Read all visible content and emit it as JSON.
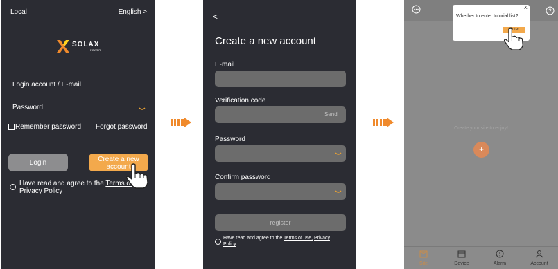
{
  "login": {
    "local": "Local",
    "language": "English >",
    "logo_text": "SOLAX",
    "logo_sub": "POWER",
    "account_label": "Login account / E-mail",
    "password_label": "Password",
    "remember": "Remember password",
    "forgot": "Forgot password",
    "login_button": "Login",
    "create_button_line1": "Create a new",
    "create_button_line2": "account",
    "agree_text": "Have read and agree to the ",
    "terms_link": "Terms of use",
    "privacy_link": "Privacy Policy"
  },
  "register": {
    "back": "<",
    "title": "Create a new account",
    "email_label": "E-mail",
    "code_label": "Verification code",
    "send": "Send",
    "password_label": "Password",
    "confirm_label": "Confirm password",
    "register_button": "register",
    "agree_text": "Have read and agree to the ",
    "terms_link": "Terms of use,",
    "privacy_link": "Privacy Policy"
  },
  "home": {
    "dialog_text": "Whether to enter tutorial list?",
    "dialog_close": "X",
    "enter_button": "Enter",
    "empty_text": "Create your site to enjoy!",
    "add_symbol": "+",
    "tabs": [
      {
        "label": "Site",
        "icon": "site-icon"
      },
      {
        "label": "Device",
        "icon": "device-icon"
      },
      {
        "label": "Alarm",
        "icon": "alarm-icon"
      },
      {
        "label": "Account",
        "icon": "account-icon"
      }
    ]
  },
  "colors": {
    "panel_bg": "#2b2c33",
    "accent": "#f08a2c",
    "button_orange": "#f3a94c",
    "button_gray": "#8d8d8f",
    "field_gray": "#6c6c6c",
    "home_bg": "#8b8b8b"
  }
}
